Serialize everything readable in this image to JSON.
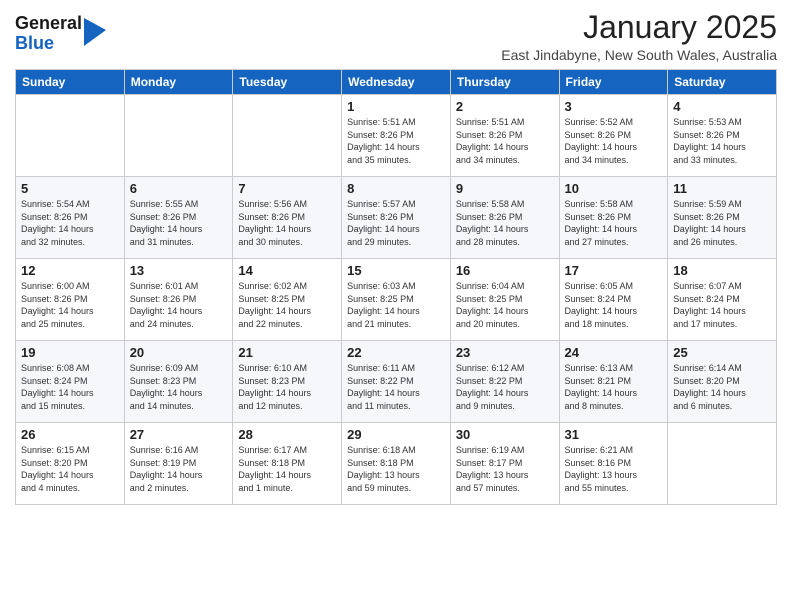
{
  "logo": {
    "line1": "General",
    "line2": "Blue"
  },
  "title": "January 2025",
  "subtitle": "East Jindabyne, New South Wales, Australia",
  "days_of_week": [
    "Sunday",
    "Monday",
    "Tuesday",
    "Wednesday",
    "Thursday",
    "Friday",
    "Saturday"
  ],
  "weeks": [
    [
      {
        "day": "",
        "info": ""
      },
      {
        "day": "",
        "info": ""
      },
      {
        "day": "",
        "info": ""
      },
      {
        "day": "1",
        "info": "Sunrise: 5:51 AM\nSunset: 8:26 PM\nDaylight: 14 hours\nand 35 minutes."
      },
      {
        "day": "2",
        "info": "Sunrise: 5:51 AM\nSunset: 8:26 PM\nDaylight: 14 hours\nand 34 minutes."
      },
      {
        "day": "3",
        "info": "Sunrise: 5:52 AM\nSunset: 8:26 PM\nDaylight: 14 hours\nand 34 minutes."
      },
      {
        "day": "4",
        "info": "Sunrise: 5:53 AM\nSunset: 8:26 PM\nDaylight: 14 hours\nand 33 minutes."
      }
    ],
    [
      {
        "day": "5",
        "info": "Sunrise: 5:54 AM\nSunset: 8:26 PM\nDaylight: 14 hours\nand 32 minutes."
      },
      {
        "day": "6",
        "info": "Sunrise: 5:55 AM\nSunset: 8:26 PM\nDaylight: 14 hours\nand 31 minutes."
      },
      {
        "day": "7",
        "info": "Sunrise: 5:56 AM\nSunset: 8:26 PM\nDaylight: 14 hours\nand 30 minutes."
      },
      {
        "day": "8",
        "info": "Sunrise: 5:57 AM\nSunset: 8:26 PM\nDaylight: 14 hours\nand 29 minutes."
      },
      {
        "day": "9",
        "info": "Sunrise: 5:58 AM\nSunset: 8:26 PM\nDaylight: 14 hours\nand 28 minutes."
      },
      {
        "day": "10",
        "info": "Sunrise: 5:58 AM\nSunset: 8:26 PM\nDaylight: 14 hours\nand 27 minutes."
      },
      {
        "day": "11",
        "info": "Sunrise: 5:59 AM\nSunset: 8:26 PM\nDaylight: 14 hours\nand 26 minutes."
      }
    ],
    [
      {
        "day": "12",
        "info": "Sunrise: 6:00 AM\nSunset: 8:26 PM\nDaylight: 14 hours\nand 25 minutes."
      },
      {
        "day": "13",
        "info": "Sunrise: 6:01 AM\nSunset: 8:26 PM\nDaylight: 14 hours\nand 24 minutes."
      },
      {
        "day": "14",
        "info": "Sunrise: 6:02 AM\nSunset: 8:25 PM\nDaylight: 14 hours\nand 22 minutes."
      },
      {
        "day": "15",
        "info": "Sunrise: 6:03 AM\nSunset: 8:25 PM\nDaylight: 14 hours\nand 21 minutes."
      },
      {
        "day": "16",
        "info": "Sunrise: 6:04 AM\nSunset: 8:25 PM\nDaylight: 14 hours\nand 20 minutes."
      },
      {
        "day": "17",
        "info": "Sunrise: 6:05 AM\nSunset: 8:24 PM\nDaylight: 14 hours\nand 18 minutes."
      },
      {
        "day": "18",
        "info": "Sunrise: 6:07 AM\nSunset: 8:24 PM\nDaylight: 14 hours\nand 17 minutes."
      }
    ],
    [
      {
        "day": "19",
        "info": "Sunrise: 6:08 AM\nSunset: 8:24 PM\nDaylight: 14 hours\nand 15 minutes."
      },
      {
        "day": "20",
        "info": "Sunrise: 6:09 AM\nSunset: 8:23 PM\nDaylight: 14 hours\nand 14 minutes."
      },
      {
        "day": "21",
        "info": "Sunrise: 6:10 AM\nSunset: 8:23 PM\nDaylight: 14 hours\nand 12 minutes."
      },
      {
        "day": "22",
        "info": "Sunrise: 6:11 AM\nSunset: 8:22 PM\nDaylight: 14 hours\nand 11 minutes."
      },
      {
        "day": "23",
        "info": "Sunrise: 6:12 AM\nSunset: 8:22 PM\nDaylight: 14 hours\nand 9 minutes."
      },
      {
        "day": "24",
        "info": "Sunrise: 6:13 AM\nSunset: 8:21 PM\nDaylight: 14 hours\nand 8 minutes."
      },
      {
        "day": "25",
        "info": "Sunrise: 6:14 AM\nSunset: 8:20 PM\nDaylight: 14 hours\nand 6 minutes."
      }
    ],
    [
      {
        "day": "26",
        "info": "Sunrise: 6:15 AM\nSunset: 8:20 PM\nDaylight: 14 hours\nand 4 minutes."
      },
      {
        "day": "27",
        "info": "Sunrise: 6:16 AM\nSunset: 8:19 PM\nDaylight: 14 hours\nand 2 minutes."
      },
      {
        "day": "28",
        "info": "Sunrise: 6:17 AM\nSunset: 8:18 PM\nDaylight: 14 hours\nand 1 minute."
      },
      {
        "day": "29",
        "info": "Sunrise: 6:18 AM\nSunset: 8:18 PM\nDaylight: 13 hours\nand 59 minutes."
      },
      {
        "day": "30",
        "info": "Sunrise: 6:19 AM\nSunset: 8:17 PM\nDaylight: 13 hours\nand 57 minutes."
      },
      {
        "day": "31",
        "info": "Sunrise: 6:21 AM\nSunset: 8:16 PM\nDaylight: 13 hours\nand 55 minutes."
      },
      {
        "day": "",
        "info": ""
      }
    ]
  ]
}
